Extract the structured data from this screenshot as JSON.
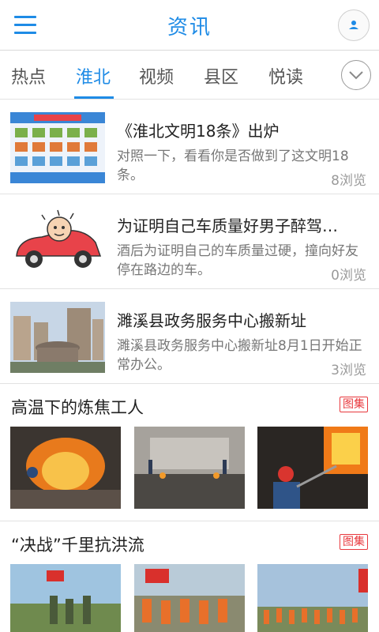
{
  "header": {
    "title": "资讯",
    "menu_icon": "menu-icon",
    "user_icon": "user-icon"
  },
  "tabs": [
    {
      "label": "热点",
      "active": false
    },
    {
      "label": "淮北",
      "active": true
    },
    {
      "label": "视频",
      "active": false
    },
    {
      "label": "县区",
      "active": false
    },
    {
      "label": "悦读",
      "active": false
    }
  ],
  "colors": {
    "accent": "#1e8be6",
    "badge": "#e8383d",
    "muted": "#9a9a9a"
  },
  "news": [
    {
      "title": "《淮北文明18条》出炉",
      "desc": "对照一下，看看你是否做到了这文明18条。",
      "views": "8浏览",
      "thumb_icon": "poster-thumbnail"
    },
    {
      "title": "为证明自己车质量好男子醉驾…",
      "desc": "酒后为证明自己的车质量过硬，撞向好友停在路边的车。",
      "views": "0浏览",
      "thumb_icon": "cartoon-car-thumbnail"
    },
    {
      "title": "濉溪县政务服务中心搬新址",
      "desc": "濉溪县政务服务中心搬新址8月1日开始正常办公。",
      "views": "3浏览",
      "thumb_icon": "building-thumbnail"
    }
  ],
  "galleries": [
    {
      "title": "高温下的炼焦工人",
      "badge": "图集"
    },
    {
      "title": "“决战”千里抗洪流",
      "badge": "图集"
    }
  ]
}
